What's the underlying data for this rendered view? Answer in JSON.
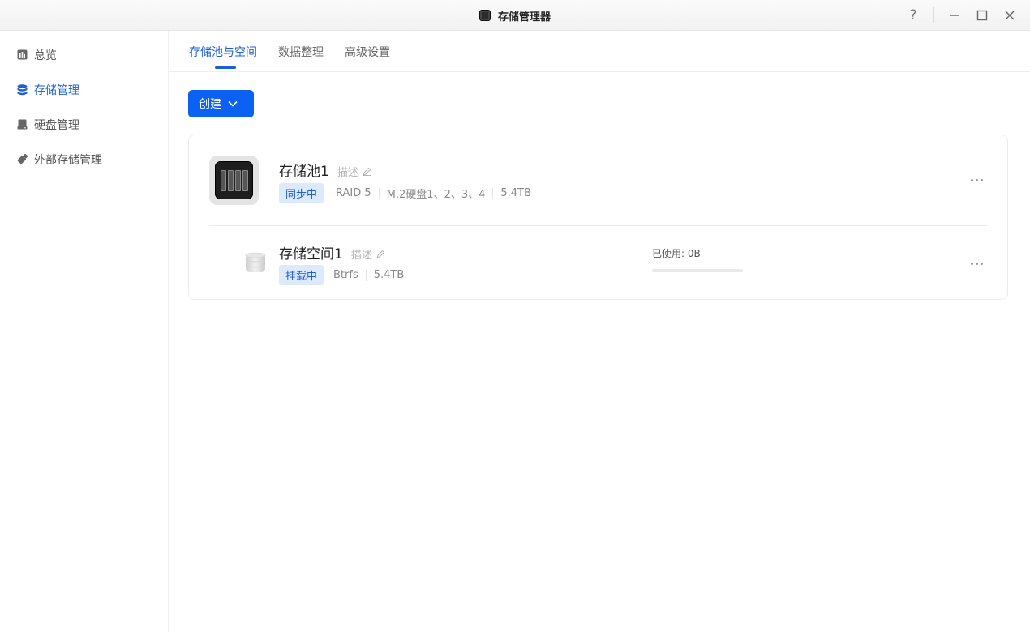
{
  "window": {
    "title": "存储管理器",
    "controls": [
      "?",
      "minimize",
      "maximize",
      "close"
    ]
  },
  "sidebar": {
    "items": [
      {
        "label": "总览",
        "icon": "chart-icon",
        "active": false
      },
      {
        "label": "存储管理",
        "icon": "database-icon",
        "active": true
      },
      {
        "label": "硬盘管理",
        "icon": "disk-icon",
        "active": false
      },
      {
        "label": "外部存储管理",
        "icon": "usb-icon",
        "active": false
      }
    ]
  },
  "tabs": [
    {
      "label": "存储池与空间",
      "active": true
    },
    {
      "label": "数据整理",
      "active": false
    },
    {
      "label": "高级设置",
      "active": false
    }
  ],
  "create_button": {
    "label": "创建"
  },
  "pool": {
    "name": "存储池1",
    "desc_label": "描述",
    "status": "同步中",
    "raid": "RAID 5",
    "disks": "M.2硬盘1、2、3、4",
    "size": "5.4TB"
  },
  "volume": {
    "name": "存储空间1",
    "desc_label": "描述",
    "status": "挂载中",
    "fs": "Btrfs",
    "size": "5.4TB",
    "usage_label": "已使用: 0B",
    "usage_fraction": 0
  },
  "colors": {
    "accent": "#0b61f2",
    "active_text": "#1d5fd8",
    "badge_bg": "#dde9fd"
  }
}
